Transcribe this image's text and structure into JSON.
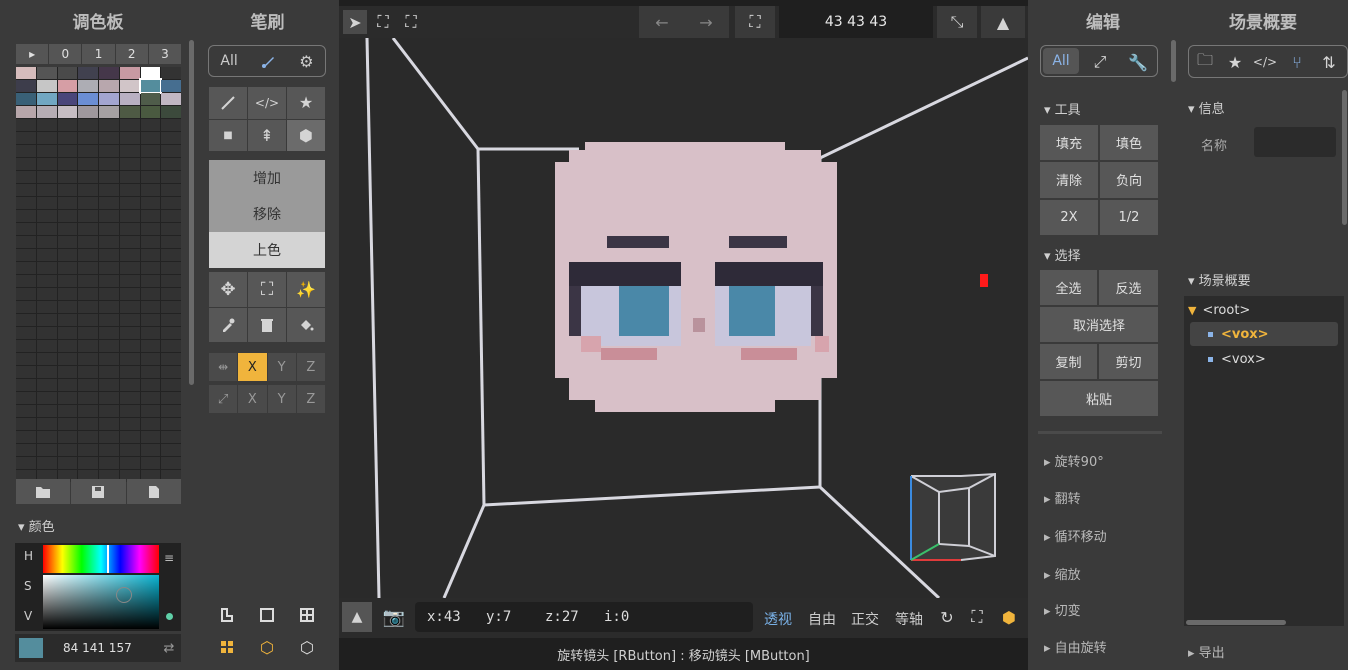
{
  "palette_panel": {
    "title": "调色板",
    "tabs": [
      "▸",
      "0",
      "1",
      "2",
      "3"
    ],
    "swatches": [
      [
        "#d6bcbc",
        "#555555",
        "#4a4a4a",
        "#41414f",
        "#45374a",
        "#c89aa3",
        "#ffffff",
        "#333333"
      ],
      [
        "#3d3d4b",
        "#c6c6c6",
        "#d69ea5",
        "#adadb4",
        "#b8a7ad",
        "#d1c5c8",
        "#5090a8",
        "#466e90"
      ],
      [
        "#396077",
        "#71a7c2",
        "#4a467a",
        "#6b8ed4",
        "#a3a5d0",
        "#b9b0c2",
        "#4f5c4a",
        "#c1b7c3"
      ],
      [
        "#b7a6aa",
        "#b6adb4",
        "#c6bdc3",
        "#9f989d",
        "#a5a0a2",
        "#4e5a44",
        "#4a5a40",
        "#3c4a3c"
      ]
    ],
    "file_icons": [
      "folder-icon",
      "save-icon",
      "file-icon"
    ],
    "color_section": "颜色",
    "h": "H",
    "s": "S",
    "v": "V",
    "rgb": "84 141 157",
    "current_color": "#548d9d"
  },
  "brush_panel": {
    "title": "笔刷",
    "filter_all": "All",
    "modes": [
      "增加",
      "移除",
      "上色"
    ],
    "axis1": [
      "X",
      "Y",
      "Z"
    ],
    "axis2": [
      "X",
      "Y",
      "Z"
    ]
  },
  "toolbar": {
    "dims": "43 43 43"
  },
  "status": {
    "coords": "x:43   y:7    z:27   i:0",
    "views": [
      "透视",
      "自由",
      "正交",
      "等轴"
    ],
    "hint": "旋转镜头 [RButton] : 移动镜头 [MButton]"
  },
  "edit_panel": {
    "title": "编辑",
    "filter_all": "All",
    "tools_label": "工具",
    "tools": [
      "填充",
      "填色",
      "清除",
      "负向",
      "2X",
      "1/2"
    ],
    "select_label": "选择",
    "select": [
      "全选",
      "反选",
      "取消选择",
      "复制",
      "剪切",
      "粘贴"
    ],
    "sections": [
      "旋转90°",
      "翻转",
      "循环移动",
      "缩放",
      "切变",
      "自由旋转"
    ]
  },
  "scene_panel": {
    "title": "场景概要",
    "info_label": "信息",
    "name_label": "名称",
    "outline_label": "场景概要",
    "tree": [
      "<root>",
      "<vox>",
      "<vox>"
    ],
    "export_label": "导出"
  }
}
